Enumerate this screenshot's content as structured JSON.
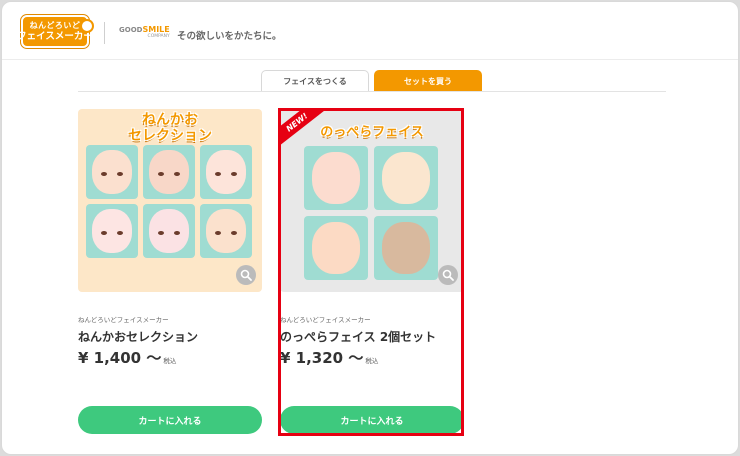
{
  "header": {
    "logo_line1": "ねんどろいど",
    "logo_line2": "フェイスメーカー",
    "brand_name_prefix": "GOOD",
    "brand_name_accent": "SMILE",
    "brand_sub": "COMPANY",
    "tagline": "その欲しいをかたちに。"
  },
  "tabs": [
    {
      "label": "フェイスをつくる",
      "active": false
    },
    {
      "label": "セットを買う",
      "active": true
    }
  ],
  "products": [
    {
      "image_title_line1": "ねんかお",
      "image_title_line2": "セレクション",
      "maker": "ねんどろいどフェイスメーカー",
      "name": "ねんかおセレクション",
      "price": "¥ 1,400 〜",
      "tax_label": "税込",
      "cart_label": "カートに入れる",
      "is_new": false,
      "selected": false,
      "face_colors": [
        "#fbe0cf",
        "#f8d7c8",
        "#fde4da",
        "#fde5e3",
        "#fbe2e4",
        "#fbe1cd"
      ],
      "face_bg": "#9fdcd2"
    },
    {
      "image_title": "のっぺらフェイス",
      "new_badge": "NEW!",
      "maker": "ねんどろいどフェイスメーカー",
      "name": "のっぺらフェイス 2個セット",
      "price": "¥ 1,320 〜",
      "tax_label": "税込",
      "cart_label": "カートに入れる",
      "is_new": true,
      "selected": true,
      "face_colors": [
        "#fcdccf",
        "#fbe6cf",
        "#fcdac4",
        "#d8b99e"
      ],
      "face_bg": "#9fdcd2"
    }
  ],
  "colors": {
    "accent_orange": "#f39800",
    "cart_green": "#3ec97e",
    "new_red": "#e60012",
    "selection_red": "#e60012"
  },
  "icons": {
    "zoom": "magnifier-icon"
  }
}
